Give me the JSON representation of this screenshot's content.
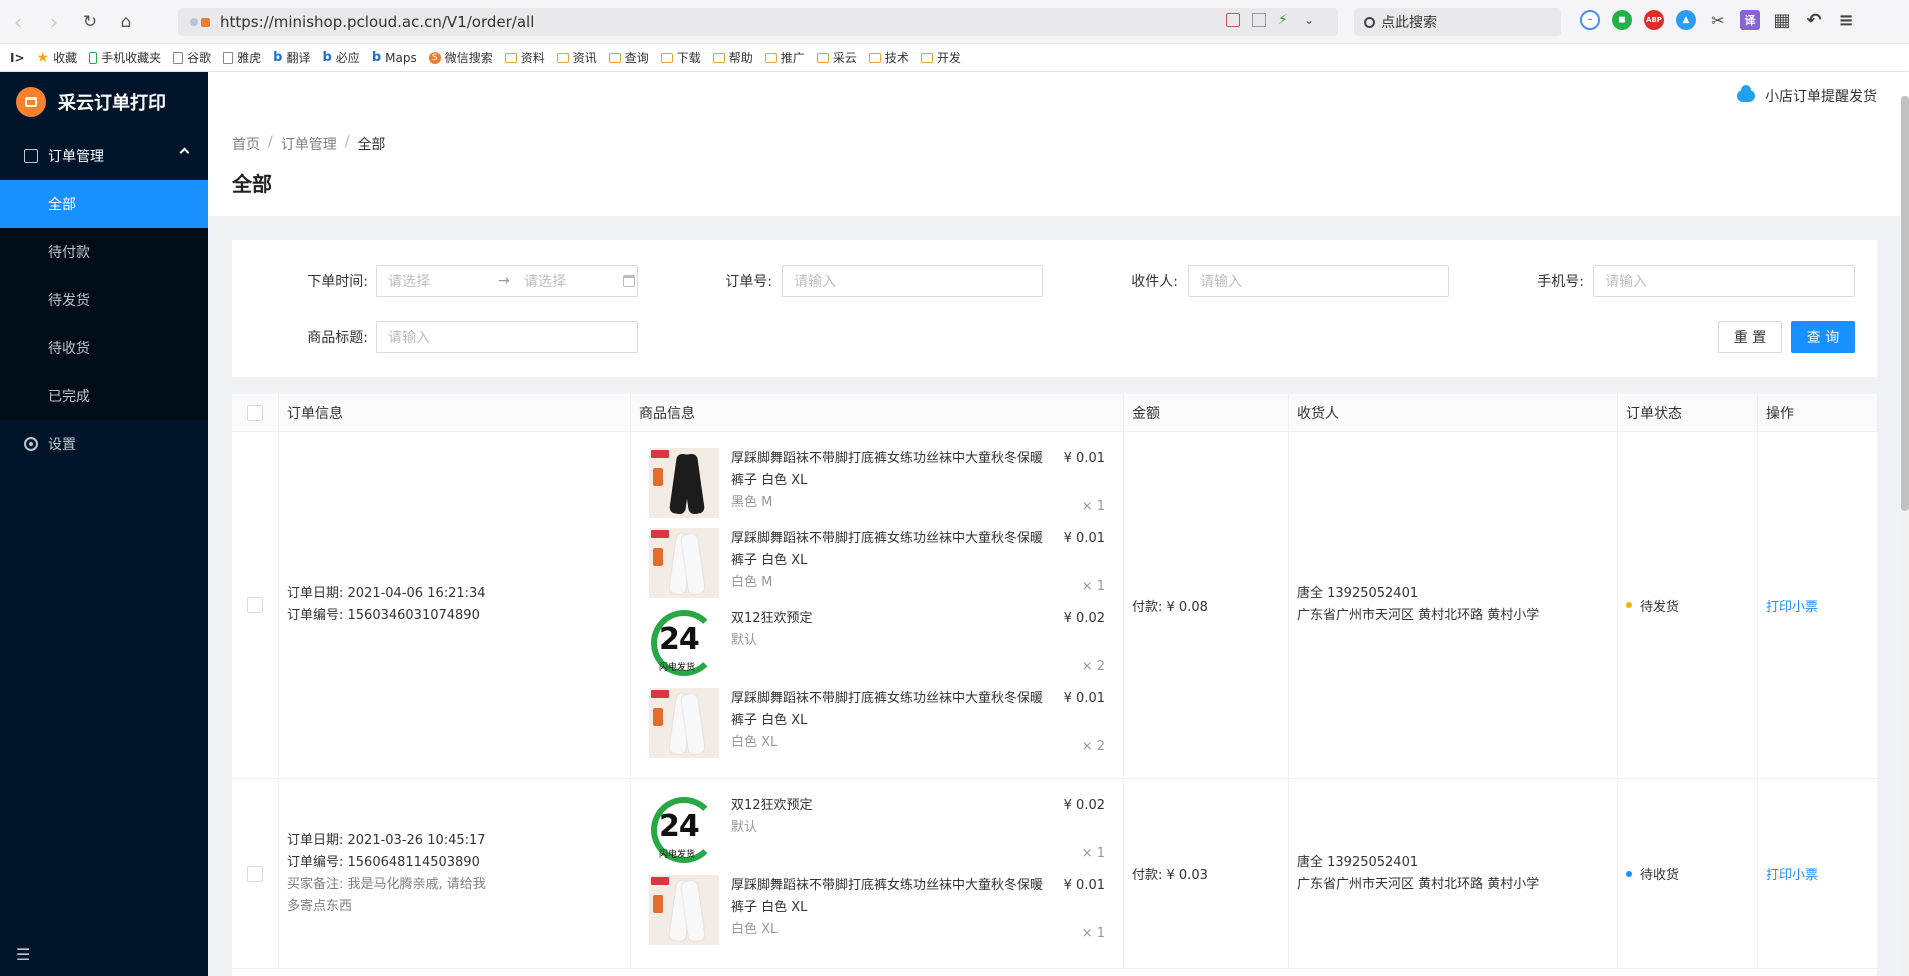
{
  "browser": {
    "url": "https://minishop.pcloud.ac.cn/V1/order/all",
    "search_placeholder": "点此搜索",
    "bookmarks": [
      "收藏",
      "手机收藏夹",
      "谷歌",
      "雅虎",
      "翻译",
      "必应",
      "Maps",
      "微信搜索",
      "资料",
      "资讯",
      "查询",
      "下载",
      "帮助",
      "推广",
      "采云",
      "技术",
      "开发"
    ]
  },
  "app": {
    "title": "采云订单打印"
  },
  "sidebar": {
    "group_label": "订单管理",
    "items": [
      "全部",
      "待付款",
      "待发货",
      "待收货",
      "已完成"
    ],
    "settings_label": "设置",
    "collapse_icon": "☰"
  },
  "topbar": {
    "notify_label": "小店订单提醒发货"
  },
  "breadcrumb": [
    "首页",
    "订单管理",
    "全部"
  ],
  "page_title": "全部",
  "filters": {
    "order_time_label": "下单时间:",
    "range_start_placeholder": "请选择",
    "range_end_placeholder": "请选择",
    "order_no_label": "订单号:",
    "order_no_placeholder": "请输入",
    "receiver_label": "收件人:",
    "receiver_placeholder": "请输入",
    "phone_label": "手机号:",
    "phone_placeholder": "请输入",
    "goods_title_label": "商品标题:",
    "goods_title_placeholder": "请输入",
    "reset_label": "重 置",
    "query_label": "查 询"
  },
  "table": {
    "headers": [
      "订单信息",
      "商品信息",
      "金额",
      "收货人",
      "订单状态",
      "操作"
    ],
    "rows": [
      {
        "date": "订单日期: 2021-04-06 16:21:34",
        "order_no": "订单编号: 1560346031074890",
        "remark": "",
        "goods": [
          {
            "title": "厚踩脚舞蹈袜不带脚打底裤女练功丝袜中大童秋冬保暖裤子 白色 XL",
            "sku": "黑色 M",
            "price": "¥ 0.01",
            "qty": "× 1"
          },
          {
            "title": "厚踩脚舞蹈袜不带脚打底裤女练功丝袜中大童秋冬保暖裤子 白色 XL",
            "sku": "白色 M",
            "price": "¥ 0.01",
            "qty": "× 1"
          },
          {
            "title": "双12狂欢预定",
            "sku": "默认",
            "price": "¥ 0.02",
            "qty": "× 2"
          },
          {
            "title": "厚踩脚舞蹈袜不带脚打底裤女练功丝袜中大童秋冬保暖裤子 白色 XL",
            "sku": "白色 XL",
            "price": "¥ 0.01",
            "qty": "× 2"
          }
        ],
        "amount": "付款: ¥ 0.08",
        "receiver": "唐全 13925052401",
        "address": "广东省广州市天河区 黄村北环路 黄村小学",
        "status": "待发货",
        "status_color": "#faad14",
        "action": "打印小票"
      },
      {
        "date": "订单日期: 2021-03-26 10:45:17",
        "order_no": "订单编号: 1560648114503890",
        "remark": "买家备注: 我是马化腾亲戚, 请给我多寄点东西",
        "goods": [
          {
            "title": "双12狂欢预定",
            "sku": "默认",
            "price": "¥ 0.02",
            "qty": "× 1"
          },
          {
            "title": "厚踩脚舞蹈袜不带脚打底裤女练功丝袜中大童秋冬保暖裤子 白色 XL",
            "sku": "白色 XL",
            "price": "¥ 0.01",
            "qty": "× 1"
          }
        ],
        "amount": "付款: ¥ 0.03",
        "receiver": "唐全 13925052401",
        "address": "广东省广州市天河区 黄村北环路 黄村小学",
        "status": "待收货",
        "status_color": "#1890ff",
        "action": "打印小票"
      }
    ]
  },
  "thumbs": {
    "badge_number": "24",
    "badge_caption": "闪电发货"
  }
}
